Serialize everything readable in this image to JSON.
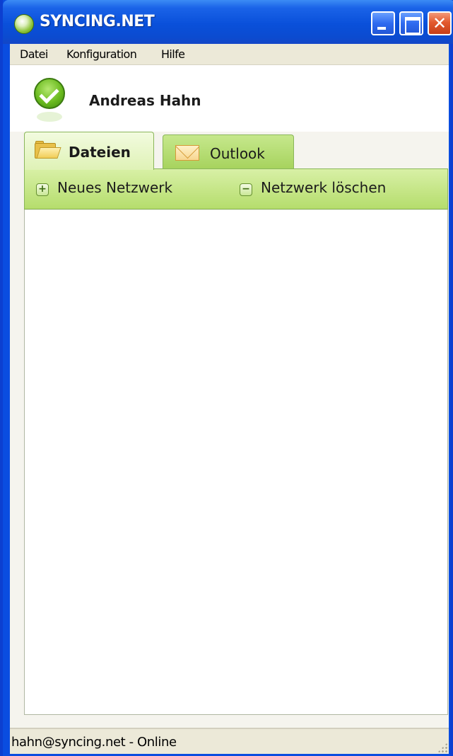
{
  "window": {
    "title": "SYNCING.NET"
  },
  "menu": {
    "items": [
      "Datei",
      "Konfiguration",
      "Hilfe"
    ]
  },
  "user": {
    "name": "Andreas Hahn",
    "status_icon": "check-icon"
  },
  "tabs": [
    {
      "label": "Dateien",
      "icon": "folder-icon",
      "active": true
    },
    {
      "label": "Outlook",
      "icon": "envelope-icon",
      "active": false
    }
  ],
  "toolbar": {
    "new_network": "Neues Netzwerk",
    "delete_network": "Netzwerk löschen"
  },
  "status": {
    "text": "hahn@syncing.net - Online"
  },
  "colors": {
    "titlebar": "#0a50da",
    "accent_green": "#b5dd6c",
    "close_button": "#e35a2e"
  }
}
